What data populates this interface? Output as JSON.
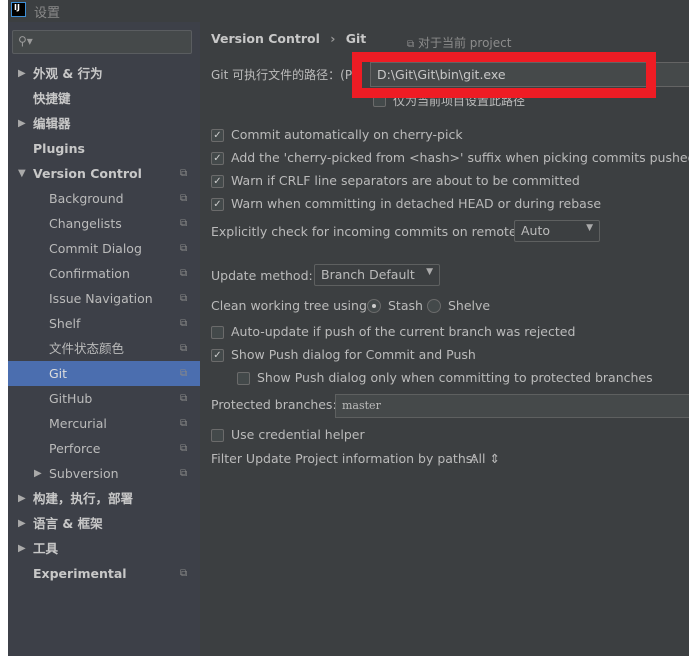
{
  "window": {
    "title": "设置",
    "logo": "IJ"
  },
  "sidebar": {
    "search_placeholder": "",
    "items": [
      {
        "label": "外观 & 行为",
        "arrow": "▶"
      },
      {
        "label": "快捷键"
      },
      {
        "label": "编辑器",
        "arrow": "▶"
      },
      {
        "label": "Plugins"
      },
      {
        "label": "Version Control",
        "arrow": "▼"
      },
      {
        "label": "Background"
      },
      {
        "label": "Changelists"
      },
      {
        "label": "Commit Dialog"
      },
      {
        "label": "Confirmation"
      },
      {
        "label": "Issue Navigation"
      },
      {
        "label": "Shelf"
      },
      {
        "label": "文件状态颜色"
      },
      {
        "label": "Git",
        "selected": true
      },
      {
        "label": "GitHub"
      },
      {
        "label": "Mercurial"
      },
      {
        "label": "Perforce"
      },
      {
        "label": "Subversion",
        "arrow": "▶"
      },
      {
        "label": "构建，执行，部署",
        "arrow": "▶"
      },
      {
        "label": "语言 & 框架",
        "arrow": "▶"
      },
      {
        "label": "工具",
        "arrow": "▶"
      },
      {
        "label": "Experimental"
      }
    ]
  },
  "main": {
    "breadcrumb": [
      "Version Control",
      "Git"
    ],
    "breadcrumb_sep": "›",
    "scope": "对于当前 project",
    "git_path_label": "Git 可执行文件的路径：(P)",
    "git_path_value": "D:\\Git\\Git\\bin\\git.exe",
    "project_only_label": "仅为当前项目设置此路径",
    "checks": [
      {
        "label": "Commit automatically on cherry-pick",
        "checked": true
      },
      {
        "label": "Add the 'cherry-picked from <hash>' suffix when picking commits pushed to protected branches",
        "checked": true
      },
      {
        "label": "Warn if CRLF line separators are about to be committed",
        "checked": true
      },
      {
        "label": "Warn when committing in detached HEAD or during rebase",
        "checked": true
      }
    ],
    "incoming_label": "Explicitly check for incoming commits on remotes:",
    "incoming_value": "Auto",
    "update_label": "Update method:",
    "update_value": "Branch Default",
    "clean_label": "Clean working tree using:",
    "clean_options": [
      {
        "label": "Stash",
        "selected": true
      },
      {
        "label": "Shelve",
        "selected": false
      }
    ],
    "auto_update_label": "Auto-update if push of the current branch was rejected",
    "show_push_label": "Show Push dialog for Commit and Push",
    "show_push_protected_label": "Show Push dialog only when committing to protected branches",
    "protected_label": "Protected branches:",
    "protected_value": "master",
    "credential_label": "Use credential helper",
    "filter_label": "Filter Update Project information by paths:",
    "filter_value": "All ⇕"
  },
  "colors": {
    "selection": "#4b6eaf",
    "highlight": "#ee1c24"
  }
}
